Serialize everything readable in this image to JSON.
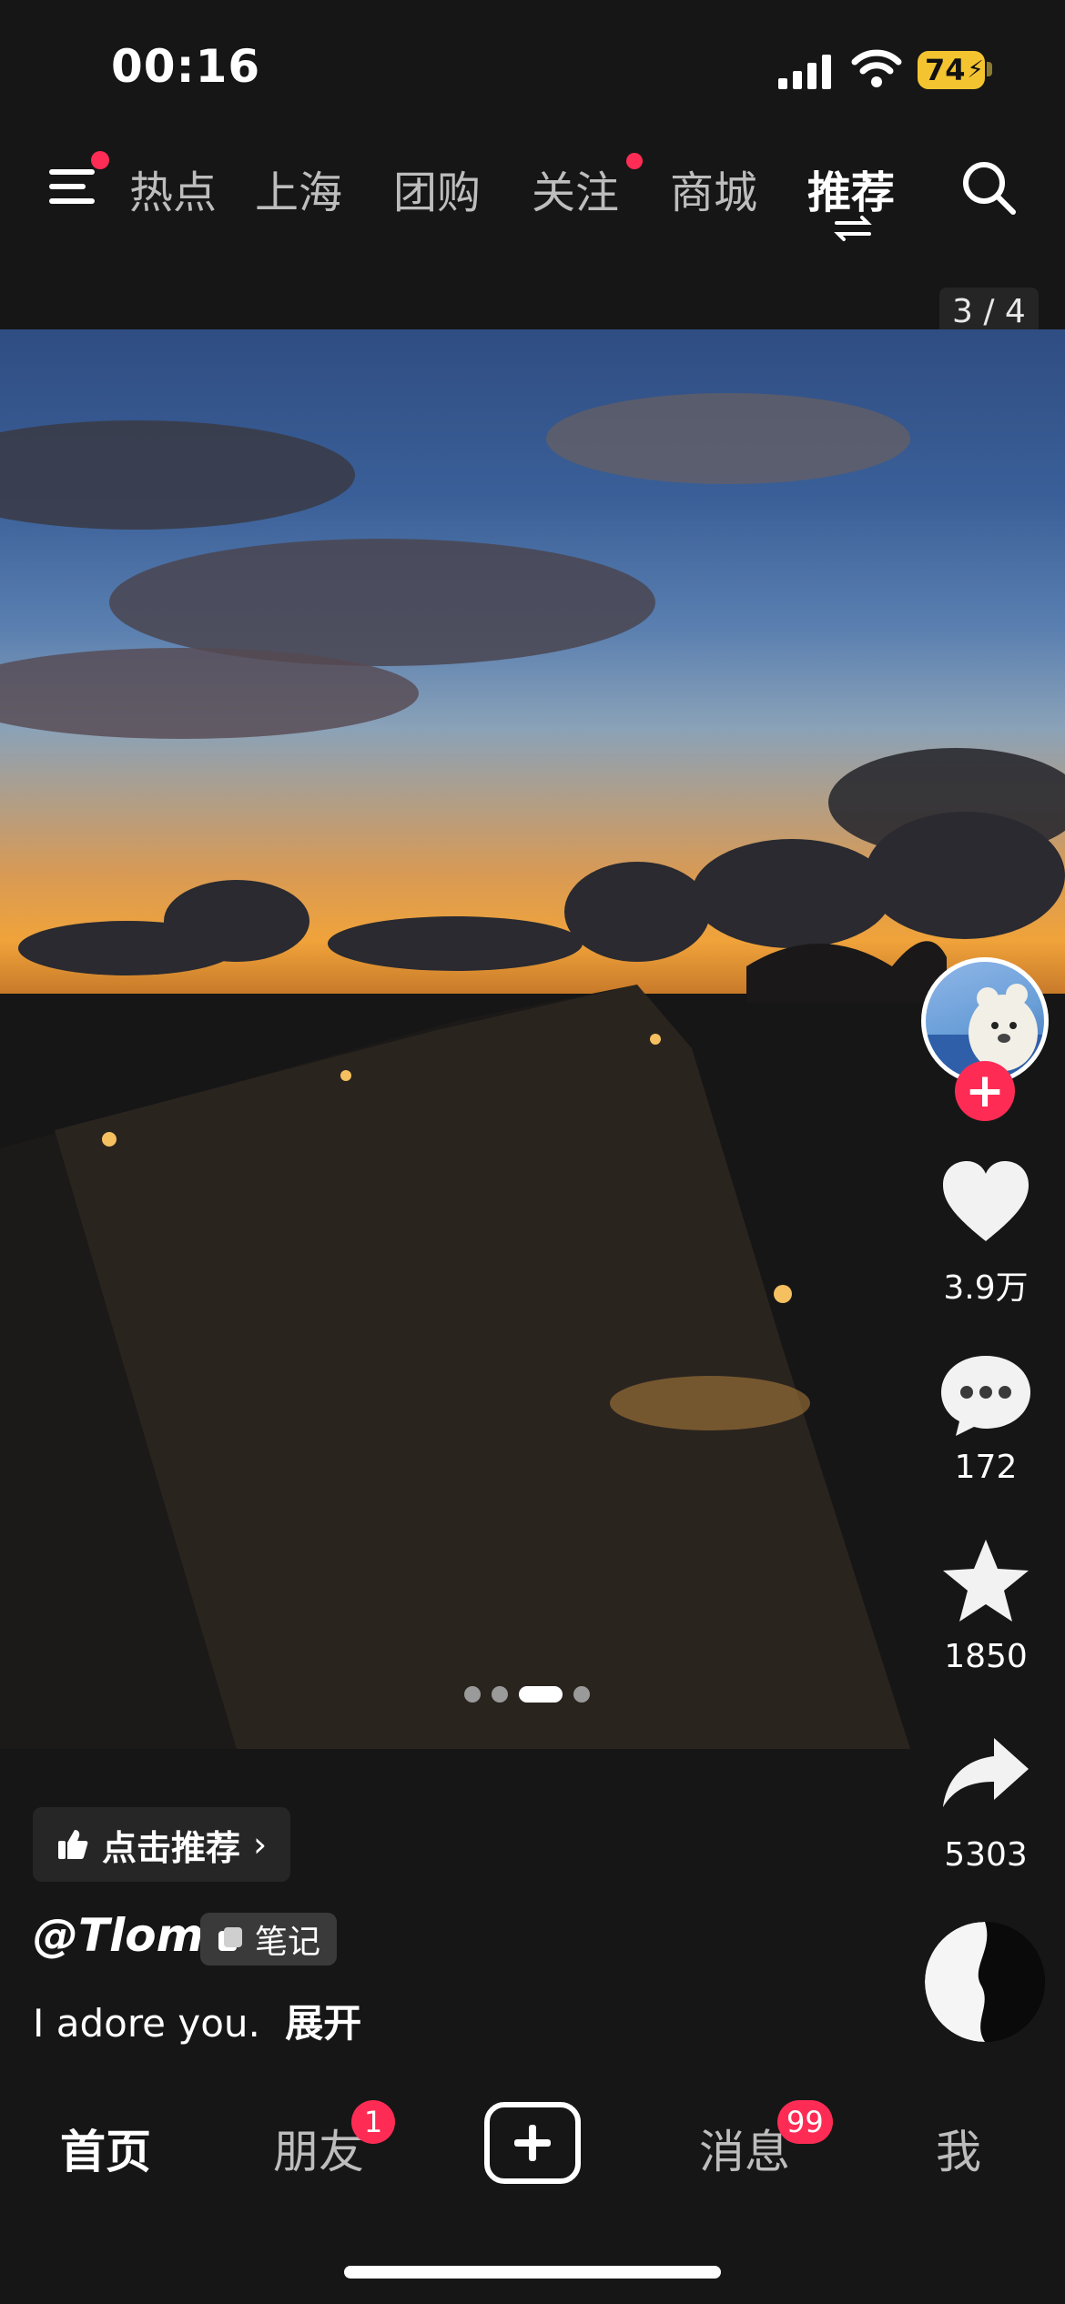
{
  "status_bar": {
    "time": "00:16",
    "battery": "74"
  },
  "top_nav": {
    "tabs": [
      {
        "label": "热点"
      },
      {
        "label": "上海"
      },
      {
        "label": "团购"
      },
      {
        "label": "关注"
      },
      {
        "label": "商城"
      },
      {
        "label": "推荐"
      }
    ],
    "active_tab": "推荐"
  },
  "media": {
    "page_counter": "3 / 4",
    "slide_count": 4,
    "active_slide": 3
  },
  "actions": {
    "likes": "3.9万",
    "comments": "172",
    "favorites": "1850",
    "shares": "5303"
  },
  "post": {
    "recommend_label": "点击推荐",
    "author": "@Tloml",
    "note_label": "笔记",
    "caption": "I adore you.",
    "expand_label": "展开"
  },
  "tab_bar": {
    "home": "首页",
    "friends": "朋友",
    "friends_badge": "1",
    "messages": "消息",
    "messages_badge": "99",
    "me": "我"
  },
  "colors": {
    "accent_red": "#fe2c55",
    "battery_yellow": "#f4c430",
    "background": "#161616"
  }
}
